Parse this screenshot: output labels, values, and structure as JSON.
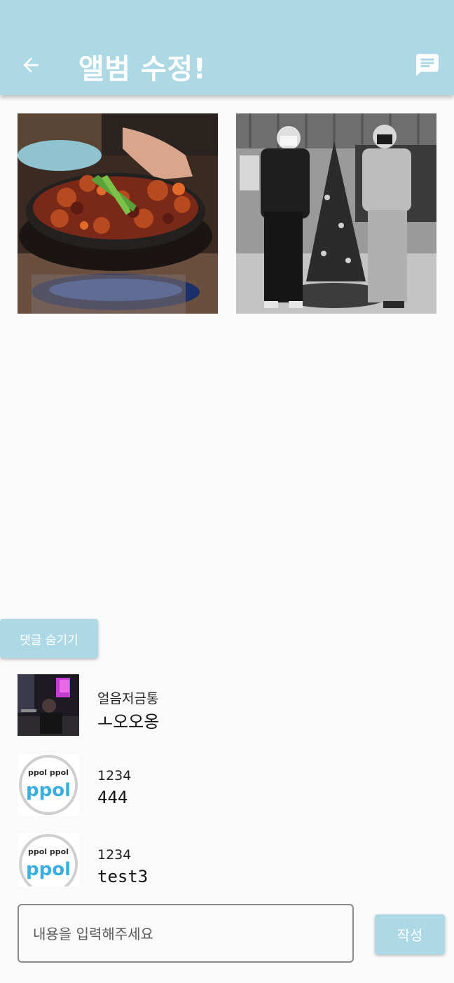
{
  "appbar": {
    "title": "앨범 수정!",
    "back_icon": "arrow-back-icon",
    "chat_icon": "chat-icon",
    "color": "#add8e6"
  },
  "photos": [
    {
      "description_icon": "food-photo"
    },
    {
      "description_icon": "people-photo"
    }
  ],
  "comments_toggle": {
    "label": "댓글 숨기기"
  },
  "comments": [
    {
      "user": "얼음저금통",
      "text": "ㅗ오오옹",
      "avatar": "night-photo-avatar"
    },
    {
      "user": "1234",
      "text": "444",
      "avatar": "ppol-avatar"
    },
    {
      "user": "1234",
      "text": "test3",
      "avatar": "ppol-avatar"
    }
  ],
  "avatar_label": {
    "top": "ppol ppol",
    "main": "ppol"
  },
  "composer": {
    "placeholder": "내용을 입력해주세요",
    "value": "",
    "submit_label": "작성"
  }
}
